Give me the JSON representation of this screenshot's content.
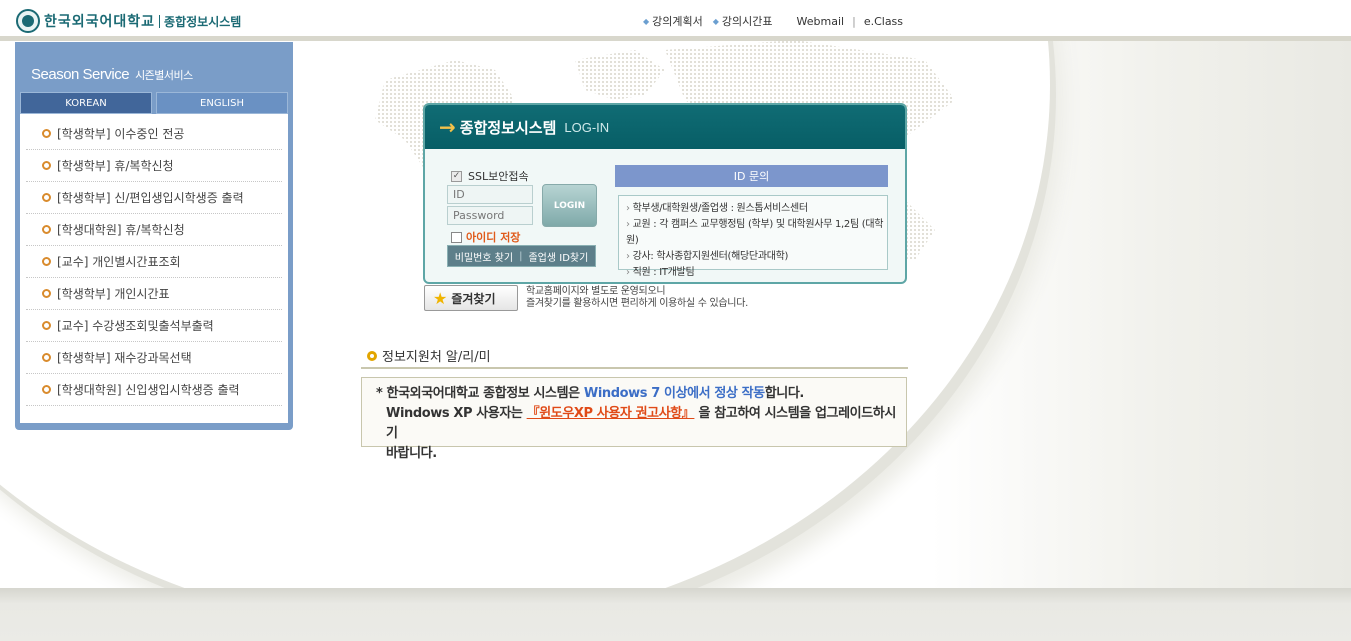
{
  "header": {
    "logo_name": "한국외국어대학교",
    "logo_sub": "종합정보시스템",
    "links": [
      "강의계획서",
      "강의시간표",
      "Webmail",
      "e.Class"
    ]
  },
  "sidebar": {
    "title": "Season Service",
    "title_ko": "시즌별서비스",
    "tabs": [
      "KOREAN",
      "ENGLISH"
    ],
    "items": [
      {
        "label": "[학생학부] 이수중인 전공"
      },
      {
        "label": "[학생학부] 휴/복학신청"
      },
      {
        "label": "[학생학부] 신/편입생입시학생증 출력"
      },
      {
        "label": "[학생대학원] 휴/복학신청"
      },
      {
        "label": "[교수] 개인별시간표조회"
      },
      {
        "label": "[학생학부] 개인시간표"
      },
      {
        "label": "[교수] 수강생조회및출석부출력"
      },
      {
        "label": "[학생학부] 재수강과목선택"
      },
      {
        "label": "[학생대학원] 신입생입시학생증 출력"
      }
    ]
  },
  "login": {
    "title": "종합정보시스템",
    "title_en": "LOG-IN",
    "ssl_label": "SSL보안접속",
    "id_placeholder": "ID",
    "password_placeholder": "Password",
    "login_button": "LOGIN",
    "save_id_label": "아이디 저장",
    "find_password": "비밀번호 찾기",
    "find_separator": "|",
    "find_alumni_id": "졸업생 ID찾기",
    "id_inquiry_title": "ID 문의",
    "id_inquiry_lines": [
      "학부생/대학원생/졸업생 : 원스톱서비스센터",
      "교원 : 각 캠퍼스 교무행정팀 (학부) 및 대학원사무 1,2팀 (대학원)",
      "강사:  학사종합지원센터(해당단과대학)",
      "직원 :  IT개발팀"
    ]
  },
  "favorites": {
    "button": "즐겨찾기",
    "text_line1": "학교홈페이지와 별도로 운영되오니",
    "text_line2": "즐겨찾기를 활용하시면 편리하게 이용하실 수 있습니다."
  },
  "notice": {
    "title": "정보지원처 알/리/미",
    "line1_prefix": "* 한국외국어대학교 종합정보 시스템은 ",
    "line1_highlight": "Windows 7 이상에서 정상 작동",
    "line1_suffix": "합니다.",
    "line2_prefix": "Windows XP 사용자는 ",
    "line2_link": "『윈도우XP 사용자 권고사항』",
    "line2_suffix": " 을 참고하여 시스템을 업그레이드하시기",
    "line3": "바랍니다."
  },
  "colors": {
    "brand_teal": "#106c74",
    "sidebar_blue": "#7a9dc8",
    "accent_orange": "#e04a17",
    "accent_blue": "#3c6ec6"
  }
}
